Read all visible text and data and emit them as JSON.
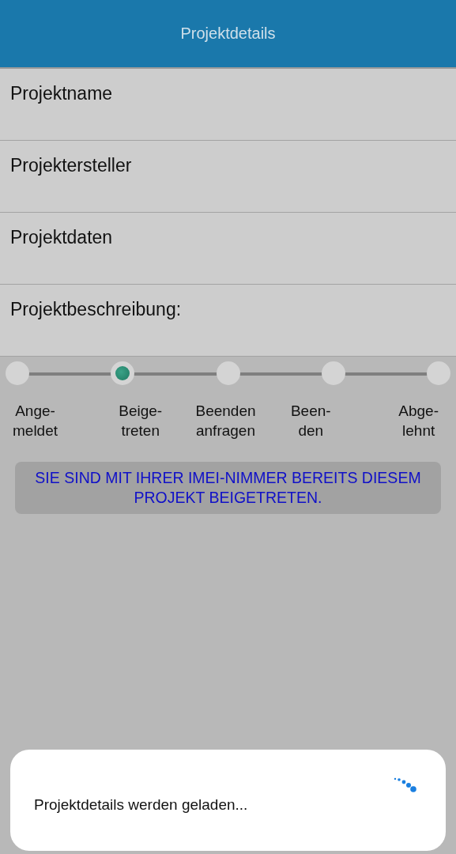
{
  "app_bar": {
    "title": "Projektdetails"
  },
  "fields": [
    {
      "label": "Projektname"
    },
    {
      "label": "Projektersteller"
    },
    {
      "label": "Projektdaten"
    },
    {
      "label": "Projektbeschreibung:"
    }
  ],
  "steps": [
    {
      "label": "Ange-\nmeldet",
      "selected": false
    },
    {
      "label": "Beige-\ntreten",
      "selected": true
    },
    {
      "label": "Beenden\nanfragen",
      "selected": false
    },
    {
      "label": "Been-\nden",
      "selected": false
    },
    {
      "label": "Abge-\nlehnt",
      "selected": false
    }
  ],
  "notice": "SIE SIND MIT IHRER IMEI-NIMMER BEREITS DIESEM PROJEKT BEIGETRETEN.",
  "dialog": {
    "message": "Projektdetails werden geladen..."
  }
}
